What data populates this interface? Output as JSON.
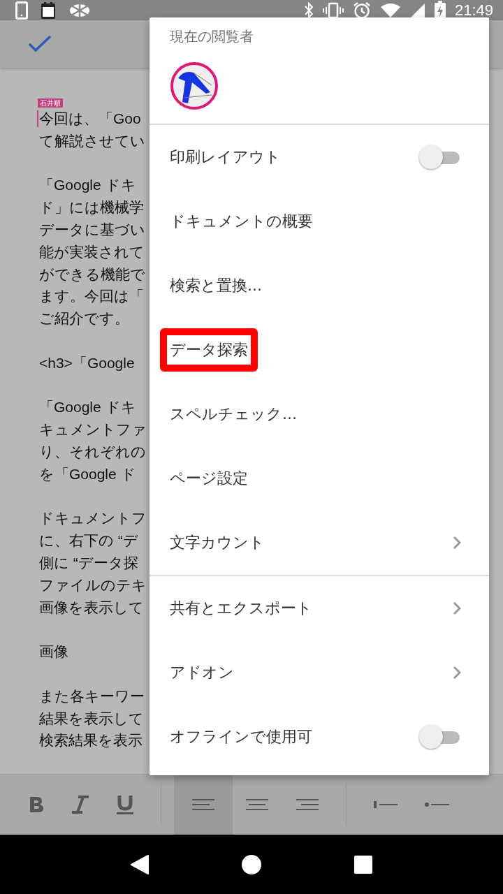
{
  "status_bar": {
    "time": "21:49"
  },
  "document": {
    "comment_tag": "石井順",
    "paragraphs": [
      [
        "今回は、「Goo",
        "て解説させてい"
      ],
      [
        "「Google ドキ",
        "ド」には機械学",
        "データに基づい",
        "能が実装されて",
        "ができる機能で",
        "ます。今回は「",
        "ご紹介です。"
      ],
      [
        "<h3>「Google"
      ],
      [
        "「Google ドキ",
        "キュメントファ",
        "り、それぞれの",
        "を「Google ド"
      ],
      [
        "ドキュメントフ",
        "に、右下の “デ",
        "側に “データ探",
        "ファイルのテキ",
        "画像を表示して"
      ],
      [
        "画像"
      ],
      [
        "また各キーワー",
        "結果を表示して",
        "検索結果を表示"
      ]
    ]
  },
  "menu": {
    "header": "現在の閲覧者",
    "items": [
      {
        "kind": "toggle",
        "label": "印刷レイアウト",
        "on": false,
        "highlighted": false
      },
      {
        "kind": "action",
        "label": "ドキュメントの概要",
        "highlighted": false
      },
      {
        "kind": "action",
        "label": "検索と置換...",
        "highlighted": false
      },
      {
        "kind": "action",
        "label": "データ探索",
        "highlighted": true
      },
      {
        "kind": "action",
        "label": "スペルチェック...",
        "highlighted": false
      },
      {
        "kind": "action",
        "label": "ページ設定",
        "highlighted": false
      },
      {
        "kind": "submenu",
        "label": "文字カウント",
        "highlighted": false
      },
      {
        "kind": "divider"
      },
      {
        "kind": "submenu",
        "label": "共有とエクスポート",
        "highlighted": false
      },
      {
        "kind": "submenu",
        "label": "アドオン",
        "highlighted": false
      },
      {
        "kind": "toggle",
        "label": "オフラインで使用可",
        "on": false,
        "highlighted": false
      }
    ]
  }
}
